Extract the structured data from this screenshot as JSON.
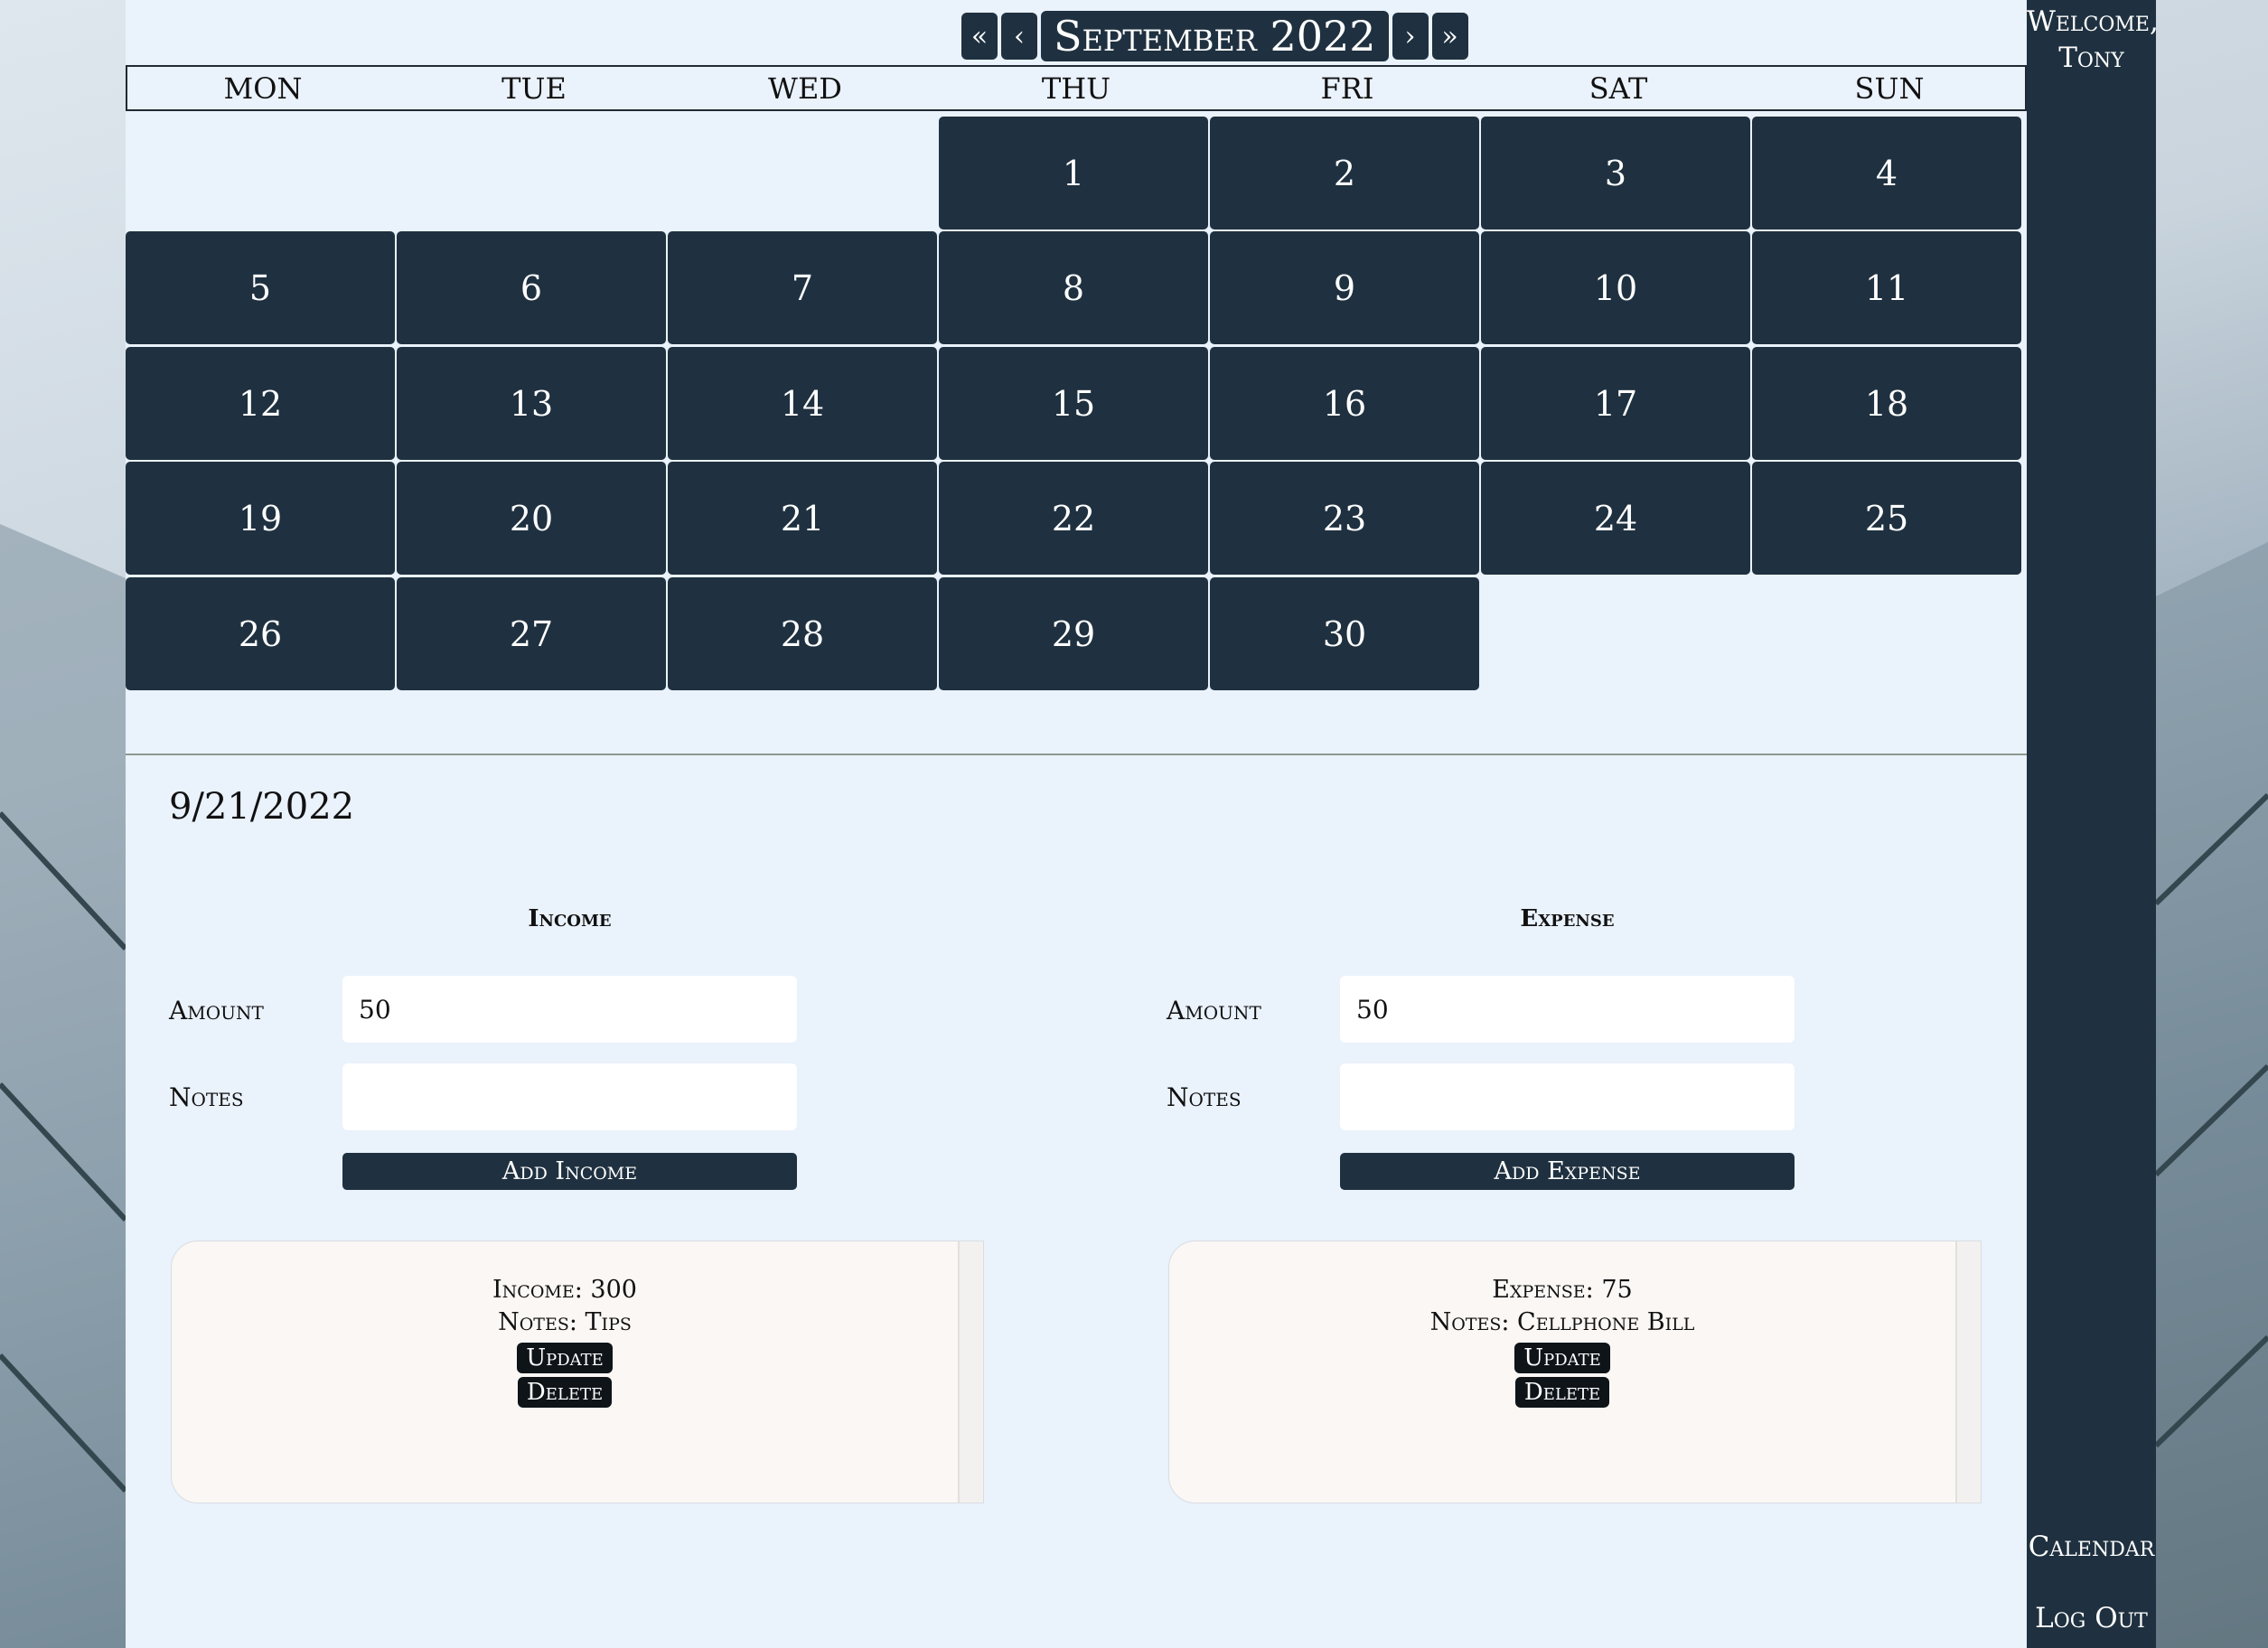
{
  "sidebar": {
    "welcome_line1": "Welcome,",
    "welcome_line2": "Tony",
    "calendar_link": "Calendar",
    "logout_link": "Log Out"
  },
  "calendar": {
    "nav_first": "«",
    "nav_prev": "‹",
    "month_title": "September 2022",
    "nav_next": "›",
    "nav_last": "»",
    "weekdays": [
      "MON",
      "TUE",
      "WED",
      "THU",
      "FRI",
      "SAT",
      "SUN"
    ],
    "days": [
      "1",
      "2",
      "3",
      "4",
      "5",
      "6",
      "7",
      "8",
      "9",
      "10",
      "11",
      "12",
      "13",
      "14",
      "15",
      "16",
      "17",
      "18",
      "19",
      "20",
      "21",
      "22",
      "23",
      "24",
      "25",
      "26",
      "27",
      "28",
      "29",
      "30"
    ]
  },
  "selected_date": "9/21/2022",
  "income": {
    "heading": "Income",
    "amount_label": "Amount",
    "amount_value": "50",
    "notes_label": "Notes",
    "notes_value": "",
    "add_button": "Add Income",
    "record": {
      "line1": "Income: 300",
      "line2": "Notes: Tips",
      "update_button": "Update",
      "delete_button": "Delete"
    }
  },
  "expense": {
    "heading": "Expense",
    "amount_label": "Amount",
    "amount_value": "50",
    "notes_label": "Notes",
    "notes_value": "",
    "add_button": "Add Expense",
    "record": {
      "line1": "Expense: 75",
      "line2": "Notes: Cellphone Bill",
      "update_button": "Update",
      "delete_button": "Delete"
    }
  },
  "colors": {
    "panel_bg": "#eaf2fc",
    "dark_navy": "#1f3140",
    "card_bg": "#faf7f4"
  }
}
